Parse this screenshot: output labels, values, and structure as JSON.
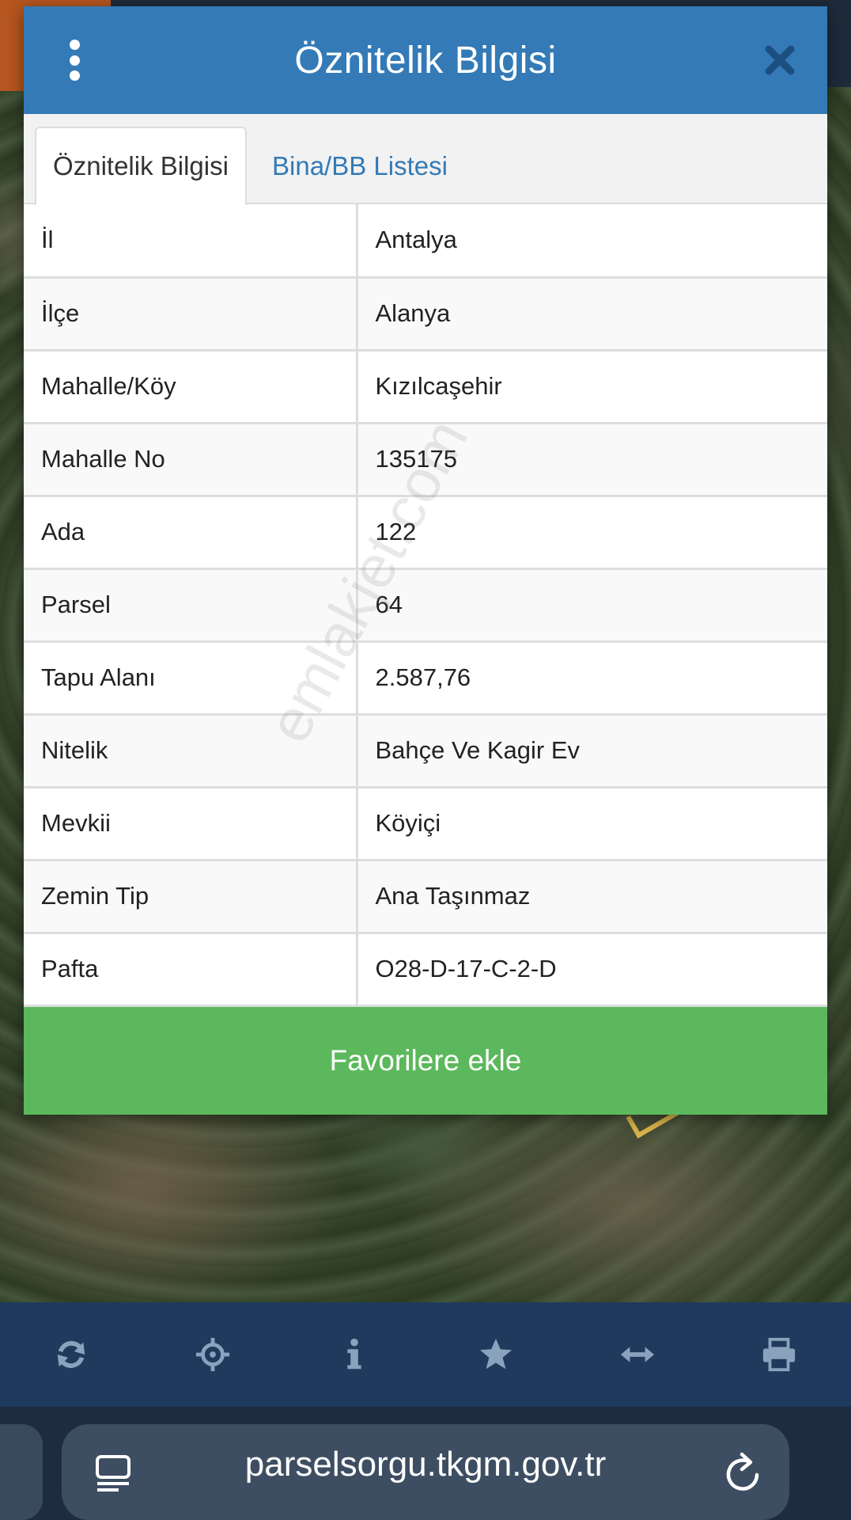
{
  "modal": {
    "title": "Öznitelik Bilgisi",
    "tabs": [
      {
        "label": "Öznitelik Bilgisi",
        "active": true
      },
      {
        "label": "Bina/BB Listesi",
        "active": false
      }
    ],
    "rows": [
      {
        "key": "İl",
        "value": "Antalya"
      },
      {
        "key": "İlçe",
        "value": "Alanya"
      },
      {
        "key": "Mahalle/Köy",
        "value": "Kızılcaşehir"
      },
      {
        "key": "Mahalle No",
        "value": "135175"
      },
      {
        "key": "Ada",
        "value": "122"
      },
      {
        "key": "Parsel",
        "value": "64"
      },
      {
        "key": "Tapu Alanı",
        "value": "2.587,76"
      },
      {
        "key": "Nitelik",
        "value": "Bahçe Ve Kagir Ev"
      },
      {
        "key": "Mevkii",
        "value": "Köyiçi"
      },
      {
        "key": "Zemin Tip",
        "value": "Ana Taşınmaz"
      },
      {
        "key": "Pafta",
        "value": "O28-D-17-C-2-D"
      }
    ],
    "favorite_button": "Favorilere ekle",
    "watermark": "emlakjet.com"
  },
  "toolbar": {
    "icons": [
      "refresh-icon",
      "crosshair-icon",
      "info-icon",
      "star-icon",
      "measure-icon",
      "print-icon"
    ]
  },
  "browser": {
    "url": "parselsorgu.tkgm.gov.tr"
  },
  "colors": {
    "header": "#337ab7",
    "favorite": "#5cb85c",
    "toolbar": "#1f3a5c",
    "toolbar_icon": "#8aa2bd"
  }
}
